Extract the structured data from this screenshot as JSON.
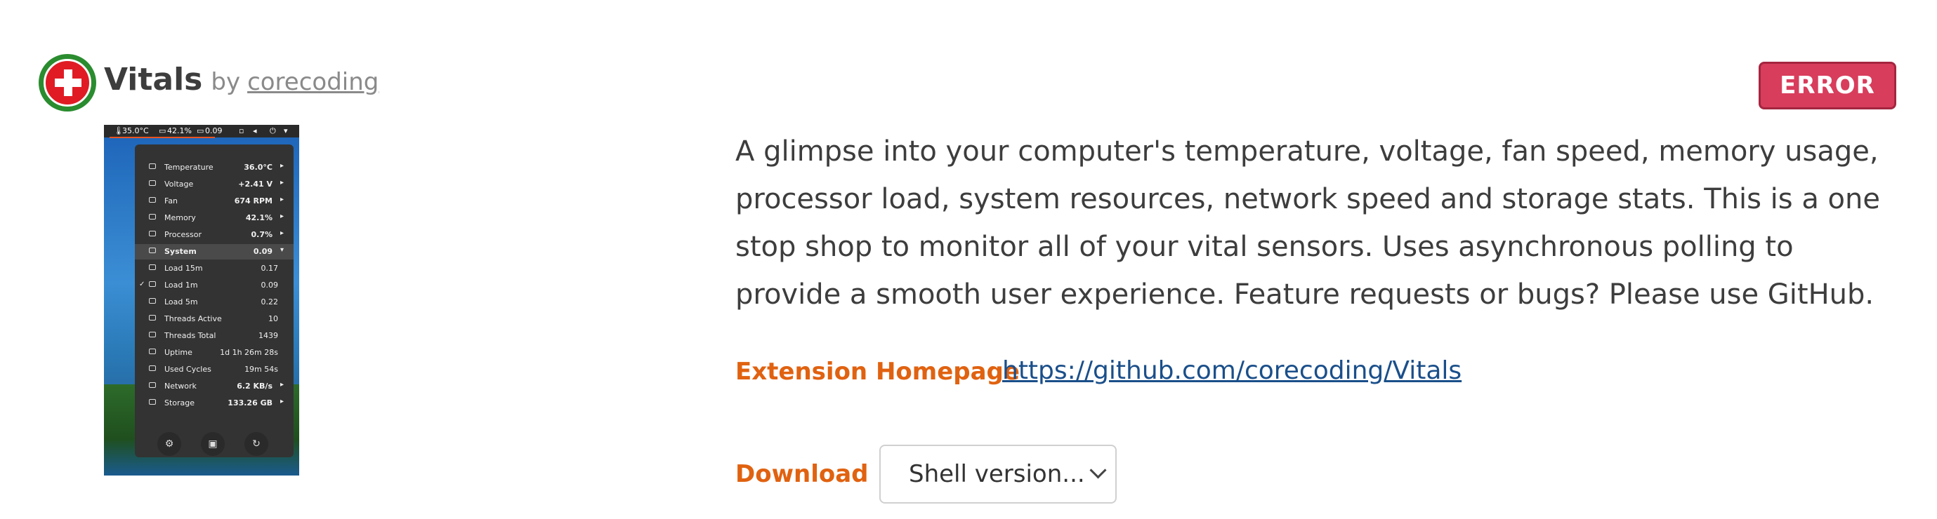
{
  "header": {
    "extension_name": "Vitals",
    "by_label": "by",
    "author": "corecoding",
    "status_button": "ERROR"
  },
  "screenshot": {
    "topbar": {
      "temp": "35.0°C",
      "memory": "42.1%",
      "load": "0.09"
    },
    "menu_items": [
      {
        "label": "Temperature",
        "value": "36.0°C",
        "arrow": "▸"
      },
      {
        "label": "Voltage",
        "value": "+2.41 V",
        "arrow": "▸"
      },
      {
        "label": "Fan",
        "value": "674 RPM",
        "arrow": "▸"
      },
      {
        "label": "Memory",
        "value": "42.1%",
        "arrow": "▸"
      },
      {
        "label": "Processor",
        "value": "0.7%",
        "arrow": "▸"
      },
      {
        "label": "System",
        "value": "0.09",
        "arrow": "▾"
      },
      {
        "label": "Load 15m",
        "value": "0.17"
      },
      {
        "label": "Load 1m",
        "value": "0.09",
        "check": "✓"
      },
      {
        "label": "Load 5m",
        "value": "0.22"
      },
      {
        "label": "Threads Active",
        "value": "10"
      },
      {
        "label": "Threads Total",
        "value": "1439"
      },
      {
        "label": "Uptime",
        "value": "1d 1h 26m 28s"
      },
      {
        "label": "Used Cycles",
        "value": "19m 54s"
      },
      {
        "label": "Network",
        "value": "6.2 KB/s",
        "arrow": "▸"
      },
      {
        "label": "Storage",
        "value": "133.26 GB",
        "arrow": "▸"
      }
    ]
  },
  "description": "A glimpse into your computer's temperature, voltage, fan speed, memory usage, processor load, system resources, network speed and storage stats. This is a one stop shop to monitor all of your vital sensors. Uses asynchronous polling to provide a smooth user experience. Feature requests or bugs? Please use GitHub.",
  "homepage": {
    "label": "Extension Homepage",
    "url": "https://github.com/corecoding/Vitals"
  },
  "download": {
    "label": "Download",
    "select_value": "Shell version..."
  },
  "colors": {
    "accent_orange": "#e06210",
    "error_red": "#d83d5c",
    "link_blue": "#1a4f8a"
  }
}
